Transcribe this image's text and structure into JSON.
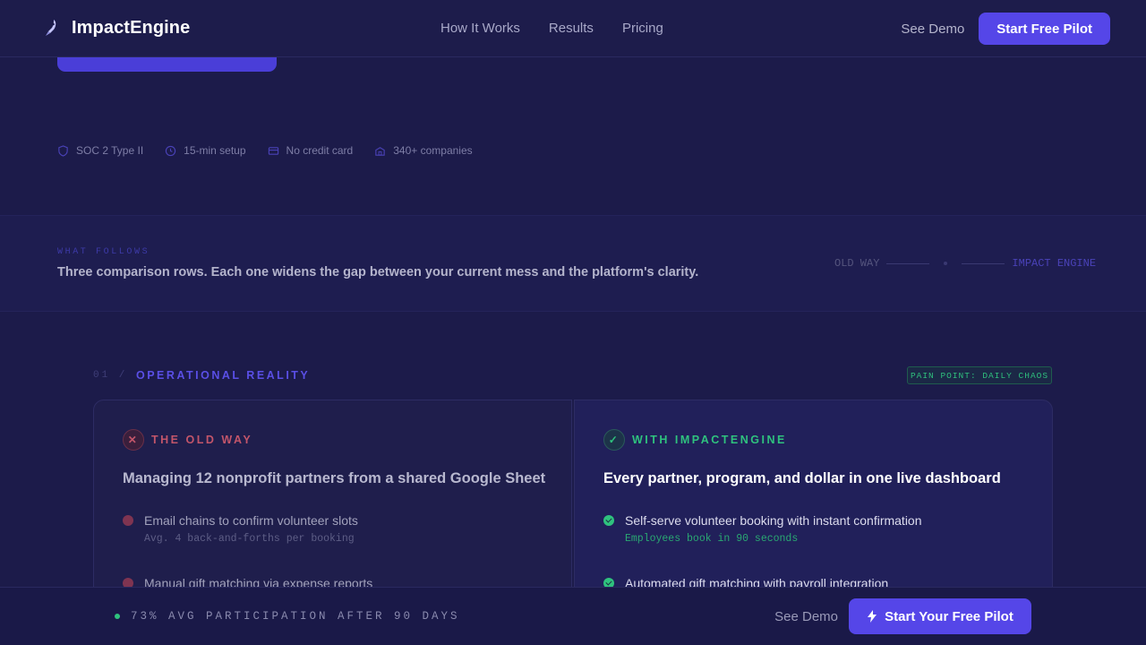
{
  "header": {
    "brand": "ImpactEngine",
    "nav": [
      "How It Works",
      "Results",
      "Pricing"
    ],
    "see_demo": "See Demo",
    "cta": "Start Free Pilot"
  },
  "trust": [
    "SOC 2 Type II",
    "15-min setup",
    "No credit card",
    "340+ companies"
  ],
  "band": {
    "eyebrow": "WHAT FOLLOWS",
    "text": "Three comparison rows. Each one widens the gap between your current mess and the platform's clarity.",
    "legend_old": "OLD WAY",
    "legend_new": "IMPACT ENGINE"
  },
  "section": {
    "number": "01 /",
    "title": "OPERATIONAL REALITY",
    "badge": "PAIN POINT: DAILY CHAOS"
  },
  "old_way": {
    "label": "THE OLD WAY",
    "title": "Managing 12 nonprofit partners from a shared Google Sheet",
    "items": [
      {
        "text": "Email chains to confirm volunteer slots",
        "sub": "Avg. 4 back-and-forths per booking"
      },
      {
        "text": "Manual gift matching via expense reports",
        "sub": ""
      }
    ]
  },
  "new_way": {
    "label": "WITH IMPACTENGINE",
    "title": "Every partner, program, and dollar in one live dashboard",
    "items": [
      {
        "text": "Self-serve volunteer booking with instant confirmation",
        "sub": "Employees book in 90 seconds"
      },
      {
        "text": "Automated gift matching with payroll integration",
        "sub": ""
      }
    ]
  },
  "footer": {
    "stat": "73% AVG PARTICIPATION AFTER 90 DAYS",
    "see_demo": "See Demo",
    "cta": "Start Your Free Pilot"
  },
  "colors": {
    "background": "#1c1b4a",
    "accent": "#5546e8",
    "old_way": "#c2556a",
    "new_way": "#2fc27e"
  }
}
